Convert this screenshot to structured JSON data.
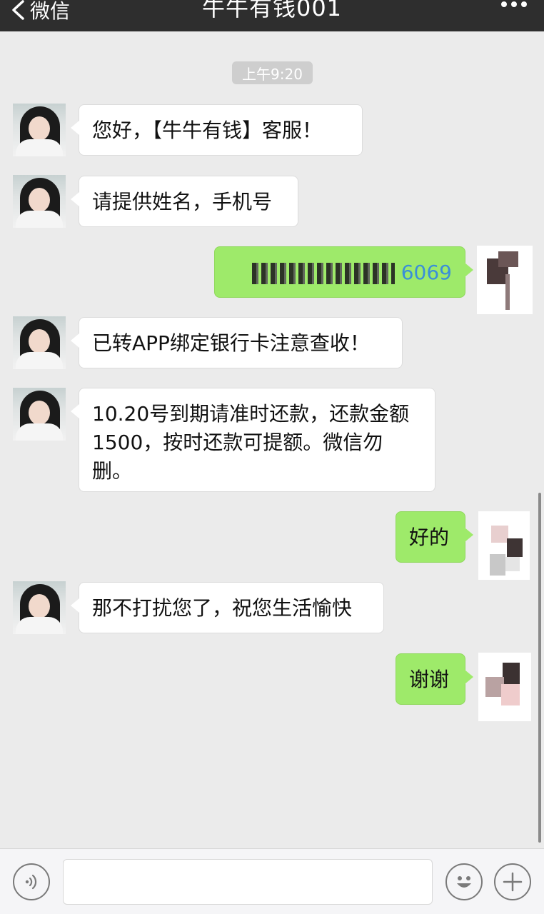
{
  "navbar": {
    "back_label": "微信",
    "title": "牛牛有钱001"
  },
  "timestamp": "上午9:20",
  "messages": [
    {
      "side": "in",
      "text": "您好，【牛牛有钱】客服！"
    },
    {
      "side": "in",
      "text": "请提供姓名，手机号"
    },
    {
      "side": "out",
      "text": "6069"
    },
    {
      "side": "in",
      "text": "已转APP绑定银行卡注意查收！"
    },
    {
      "side": "in",
      "text": "10.20号到期请准时还款，还款金额1500，按时还款可提额。微信勿删。"
    },
    {
      "side": "out",
      "text": "好的"
    },
    {
      "side": "in",
      "text": "那不打扰您了，祝您生活愉快"
    },
    {
      "side": "out",
      "text": "谢谢"
    }
  ],
  "input_bar": {
    "voice_icon": "voice-icon",
    "emoji_icon": "emoji-icon",
    "plus_icon": "plus-icon",
    "input_value": ""
  },
  "colors": {
    "navbar": "#2e2e2e",
    "background": "#ebebeb",
    "outgoing_bubble": "#9eea6a",
    "incoming_bubble": "#ffffff"
  }
}
